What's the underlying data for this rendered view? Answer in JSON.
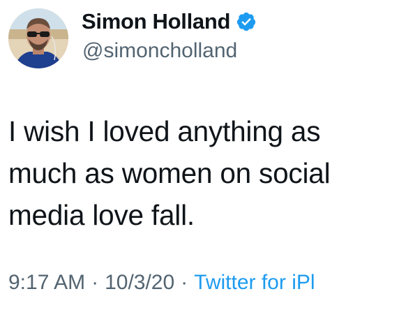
{
  "author": {
    "display_name": "Simon Holland",
    "handle": "@simoncholland",
    "verified_icon": "verified-badge-icon",
    "avatar_icon": "profile-photo"
  },
  "tweet": {
    "lines": [
      "I wish I loved anything as",
      "much as women on social",
      "media love fall."
    ]
  },
  "meta": {
    "time": "9:17 AM",
    "separator": "·",
    "date": "10/3/20",
    "source": "Twitter for iPl"
  },
  "colors": {
    "text_primary": "#0f1419",
    "text_secondary": "#536471",
    "accent_blue": "#1d9bf0"
  }
}
